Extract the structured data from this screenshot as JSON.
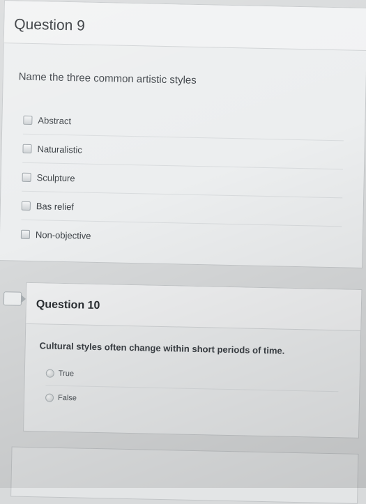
{
  "question9": {
    "title": "Question 9",
    "prompt": "Name the three common artistic styles",
    "options": [
      "Abstract",
      "Naturalistic",
      "Sculpture",
      "Bas relief",
      "Non-objective"
    ]
  },
  "question10": {
    "title": "Question 10",
    "prompt": "Cultural styles often change within short periods of time.",
    "options": [
      "True",
      "False"
    ]
  }
}
